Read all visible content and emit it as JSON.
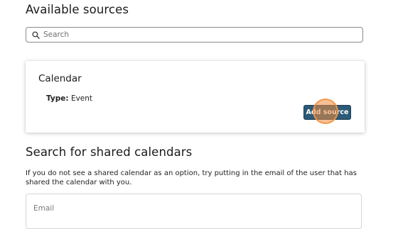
{
  "sources": {
    "title": "Available sources",
    "search": {
      "placeholder": "Search",
      "icon": "search-icon"
    },
    "card": {
      "title": "Calendar",
      "type_label": "Type:",
      "type_value": "Event",
      "button_label": "Add source",
      "button_color": "#2c5a78"
    }
  },
  "shared": {
    "title": "Search for shared calendars",
    "help_text": "If you do not see a shared calendar as an option, try putting in the email of the user that has shared the calendar with you.",
    "email": {
      "placeholder": "Email"
    }
  },
  "colors": {
    "click_indicator": "#f08c3c"
  }
}
